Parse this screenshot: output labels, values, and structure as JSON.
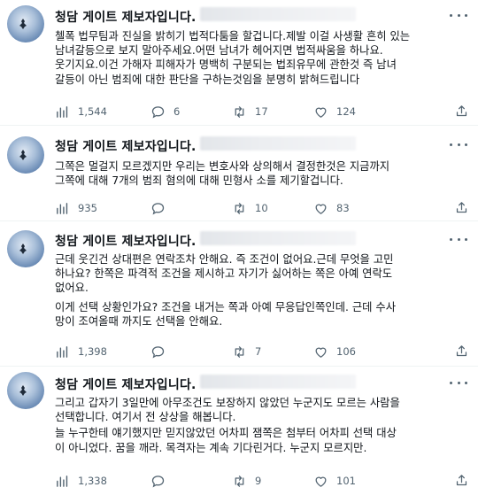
{
  "tweets": [
    {
      "author": "청담 게이트 제보자입니다.",
      "lines": [
        "첼폭 법무팀과 진실을 밝히기 법적다툼을 할겁니다.제발 이걸 사생활 흔히 있는",
        "남녀갈등으로 보지 말아주세요.어떤 남녀가 헤어지면 법적싸움을 하나요.",
        "웃기지요.이건 가해자 피해자가 명백히 구분되는 법죄유무에 관한것 즉 남녀",
        "갈등이 아닌 범죄에 대한 판단을 구하는것임을 분명히 밝혀드립니다"
      ],
      "views": "1,544",
      "replies": "6",
      "retweets": "17",
      "likes": "124"
    },
    {
      "author": "청담 게이트 제보자입니다.",
      "lines": [
        "그쪽은 멀걸지 모르겠지만 우리는 변호사와 상의해서 결정한것은 지금까지",
        "그쪽에 대해 7개의 범죄 혐의에 대해 민형사 소를 제기할겁니다."
      ],
      "views": "935",
      "replies": "",
      "retweets": "10",
      "likes": "83"
    },
    {
      "author": "청담 게이트 제보자입니다.",
      "lines": [
        "근데 웃긴건 상대편은 연락조차 안해요. 즉 조건이 없어요.근데 무엇을 고민",
        "하나요? 한쪽은 파격적 조건을 제시하고 자기가 싫어하는 쪽은 아예 연락도",
        "없어요."
      ],
      "lines2": [
        "이게 선택 상황인가요? 조건을 내거는 쪽과 아예 무응답인쪽인데. 근데 수사",
        "망이 조여올때 까지도 선택을 안해요."
      ],
      "views": "1,398",
      "replies": "",
      "retweets": "7",
      "likes": "106"
    },
    {
      "author": "청담 게이트 제보자입니다.",
      "lines": [
        "그리고 갑자기 3일만에 아무조건도 보장하지 않았던 누군지도 모르는 사람을",
        "선택합니다. 여기서 전 상상을 해봅니다."
      ],
      "lines2": [
        "늘 누구한테 얘기했지만 믿지않았던 어차피 잼쪽은 첨부터 어차피 선택 대상",
        "이 아니었다. 꿈을 깨라. 목격자는 계속 기다린거다. 누군지 모르지만."
      ],
      "views": "1,338",
      "replies": "",
      "retweets": "9",
      "likes": "101"
    }
  ],
  "icons": {
    "views": "bar-chart-icon",
    "reply": "speech-bubble-icon",
    "retweet": "retweet-icon",
    "like": "heart-icon",
    "share": "share-icon",
    "more": "more-dots-icon"
  },
  "colors": {
    "text": "#0f1419",
    "muted": "#536471",
    "divider": "#eff3f4"
  }
}
